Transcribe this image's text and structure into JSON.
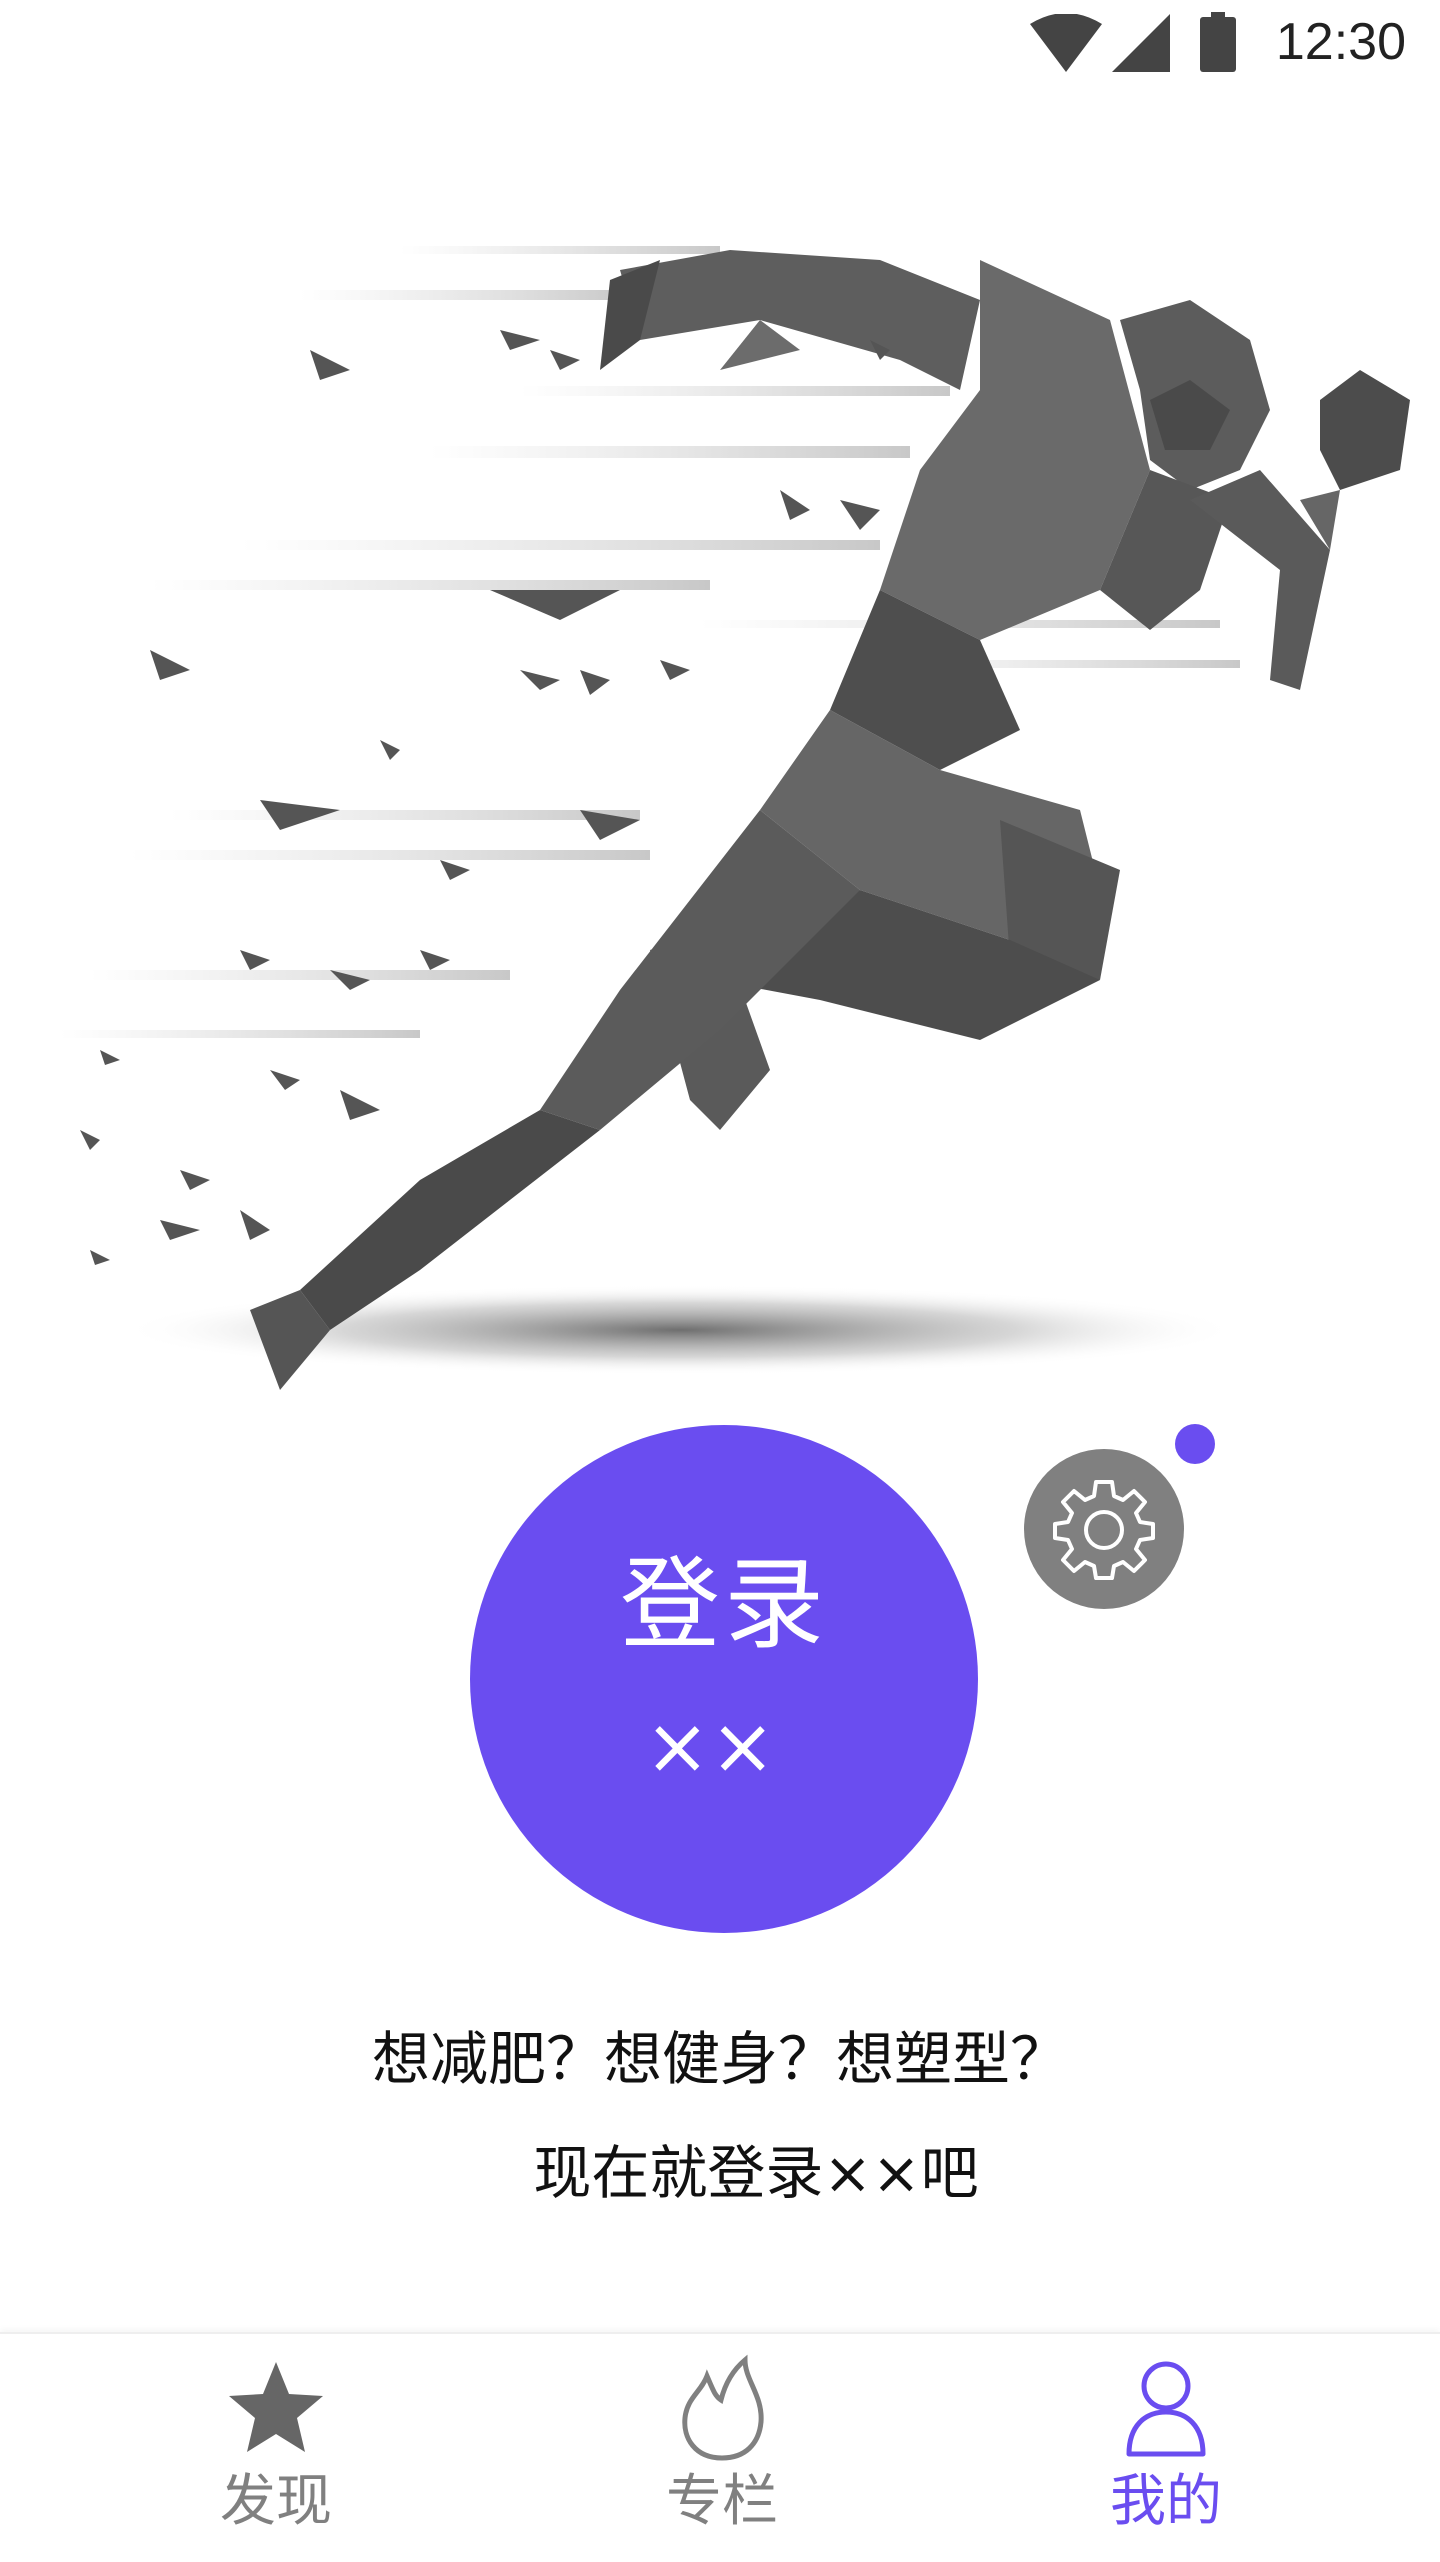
{
  "status_bar": {
    "time": "12:30",
    "icons": [
      "wifi-icon",
      "cell-signal-icon",
      "battery-icon"
    ]
  },
  "hero": {
    "illustration": "low-poly-running-man"
  },
  "login": {
    "title": "登录",
    "subtitle": "××"
  },
  "settings": {
    "icon": "gear-icon",
    "has_notification": true
  },
  "promo": {
    "line1": "想减肥？想健身？想塑型？",
    "line2": "现在就登录××吧"
  },
  "tab_bar": {
    "tabs": [
      {
        "label": "发现",
        "icon": "star-icon",
        "active": false
      },
      {
        "label": "专栏",
        "icon": "flame-icon",
        "active": false
      },
      {
        "label": "我的",
        "icon": "person-icon",
        "active": true
      }
    ]
  },
  "colors": {
    "accent": "#6a4df0",
    "inactive": "#808080",
    "figure": "#555555"
  }
}
